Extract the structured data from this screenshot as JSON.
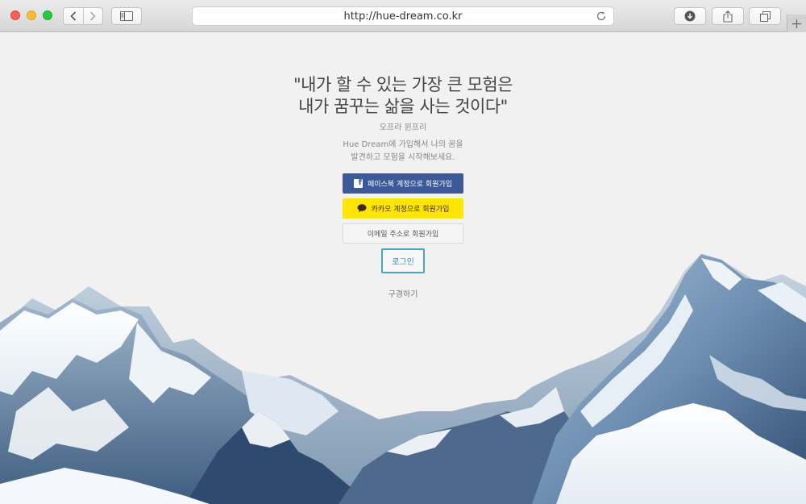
{
  "browser": {
    "url": "http://hue-dream.co.kr"
  },
  "page": {
    "quote_line1": "\"내가 할 수 있는 가장 큰 모험은",
    "quote_line2": "내가 꿈꾸는 삶을 사는 것이다\"",
    "author": "오프라 윈프리",
    "desc_line1": "Hue Dream에 가입해서 나의 꿈을",
    "desc_line2": "발견하고 모험을 시작해보세요.",
    "facebook_signup_label": "페이스북 계정으로 회원가입",
    "kakao_signup_label": "카카오 계정으로 회원가입",
    "email_signup_label": "이메일 주소로 회원가입",
    "login_label": "로그인",
    "browse_label": "구경하기"
  },
  "colors": {
    "facebook": "#3b5998",
    "kakao": "#ffe500",
    "login_border": "#4aa6c2"
  },
  "icons": [
    "back-icon",
    "forward-icon",
    "sidebar-icon",
    "reload-icon",
    "download-icon",
    "share-icon",
    "tabs-icon",
    "plus-icon",
    "facebook-icon",
    "kakao-speech-icon"
  ]
}
